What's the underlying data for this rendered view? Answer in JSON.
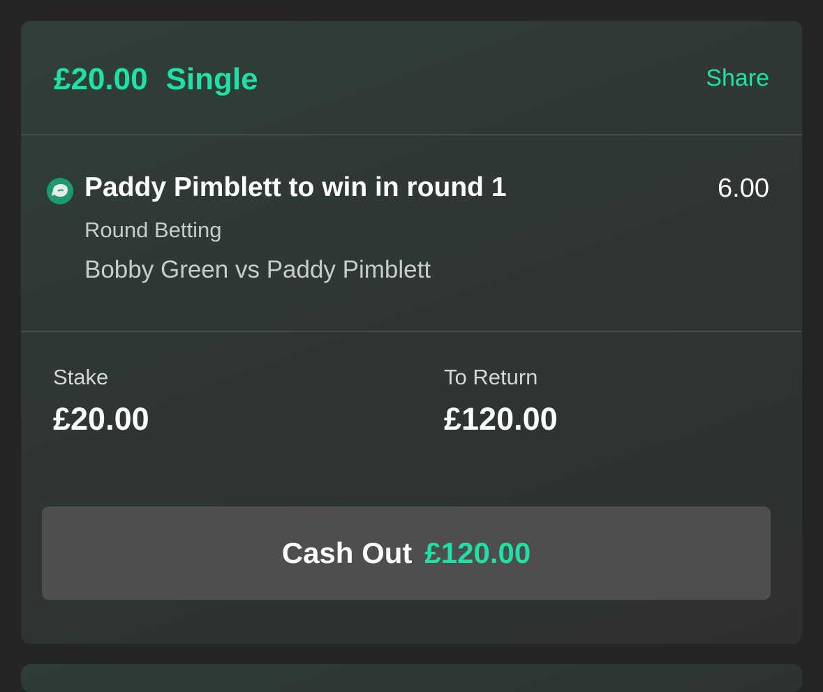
{
  "colors": {
    "accent": "#1fe0a7",
    "card_background": "#2f3733",
    "page_background": "#252525",
    "button_background": "#4e4e4e"
  },
  "bet": {
    "amount": "£20.00",
    "type": "Single",
    "share_label": "Share"
  },
  "selection": {
    "icon": "mma-glove-icon",
    "name": "Paddy Pimblett to win in round 1",
    "odds": "6.00",
    "market": "Round Betting",
    "event": "Bobby Green vs Paddy Pimblett"
  },
  "summary": {
    "stake_label": "Stake",
    "stake_value": "£20.00",
    "return_label": "To Return",
    "return_value": "£120.00"
  },
  "cashout": {
    "label": "Cash Out",
    "amount": "£120.00"
  }
}
